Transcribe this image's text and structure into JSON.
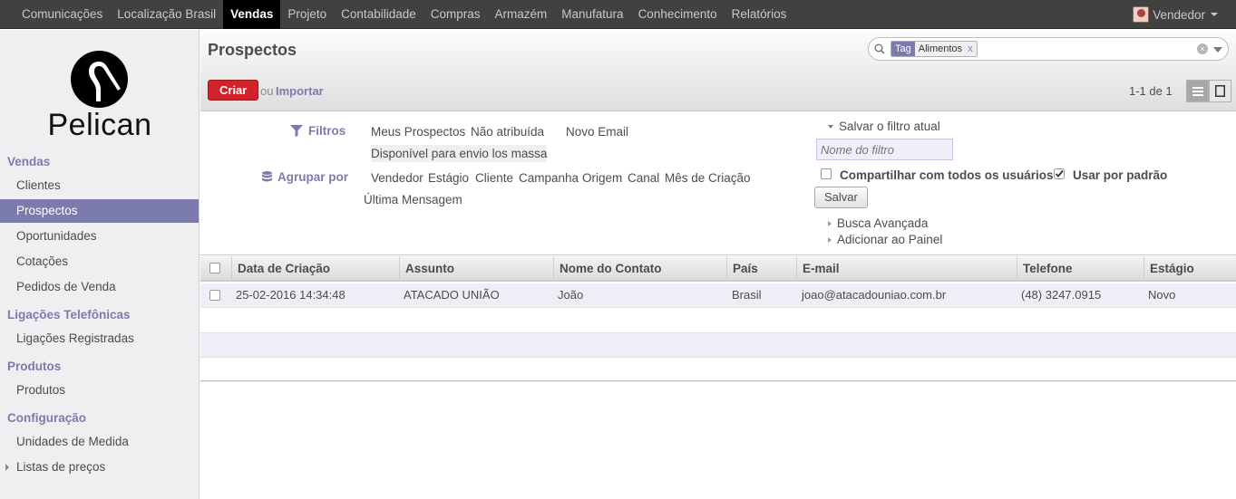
{
  "topbar": {
    "menu": [
      "Comunicações",
      "Localização Brasil",
      "Vendas",
      "Projeto",
      "Contabilidade",
      "Compras",
      "Armazém",
      "Manufatura",
      "Conhecimento",
      "Relatórios"
    ],
    "active_index": 2,
    "user_name": "Vendedor"
  },
  "sidebar": {
    "logo_text": "Pelican",
    "sections": [
      {
        "title": "Vendas",
        "items": [
          "Clientes",
          "Prospectos",
          "Oportunidades",
          "Cotações",
          "Pedidos de Venda"
        ]
      },
      {
        "title": "Ligações Telefônicas",
        "items": [
          "Ligações Registradas"
        ]
      },
      {
        "title": "Produtos",
        "items": [
          "Produtos"
        ]
      },
      {
        "title": "Configuração",
        "items": [
          "Unidades de Medida",
          "Listas de preços"
        ]
      }
    ],
    "active_item": "Prospectos"
  },
  "header": {
    "title": "Prospectos",
    "search": {
      "facet_category": "Tag",
      "facet_value": "Alimentos",
      "facet_remove": "x"
    },
    "create_label": "Criar",
    "or_label": "ou",
    "import_label": "Importar",
    "pager": "1-1 de 1"
  },
  "drawer": {
    "filters_label": "Filtros",
    "filters": [
      "Meus Prospectos",
      "Não atribuída",
      "Novo Email",
      "Disponível para envio los massa"
    ],
    "group_by_label": "Agrupar por",
    "group_by": [
      "Vendedor",
      "Estágio",
      "Cliente",
      "Campanha",
      "Origem",
      "Canal",
      "Mês de Criação",
      "Última Mensagem"
    ],
    "save_current_filter": "Salvar o filtro atual",
    "filter_name_placeholder": "Nome do filtro",
    "share_all_users": "Compartilhar com todos os usuários",
    "share_checked": false,
    "use_default": "Usar por padrão",
    "use_default_checked": true,
    "save_button": "Salvar",
    "advanced_search": "Busca Avançada",
    "add_to_dashboard": "Adicionar ao Painel"
  },
  "table": {
    "columns": [
      "Data de Criação",
      "Assunto",
      "Nome do Contato",
      "País",
      "E-mail",
      "Telefone",
      "Estágio"
    ],
    "rows": [
      [
        "25-02-2016 14:34:48",
        "ATACADO UNIÃO",
        "João",
        "Brasil",
        "joao@atacadouniao.com.br",
        "(48) 3247.0915",
        "Novo"
      ]
    ]
  },
  "colors": {
    "accent": "#7c7bad",
    "create_button": "#d2232a",
    "topbar": "#414141"
  }
}
